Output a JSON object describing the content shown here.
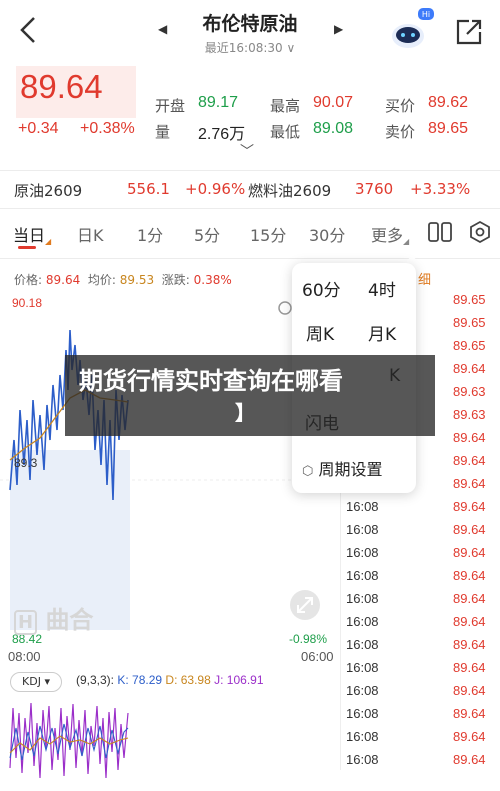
{
  "header": {
    "title": "布伦特原油",
    "subtitle": "最近16:08:30 ∨",
    "badge": "Hi"
  },
  "quote": {
    "price": "89.64",
    "change": "+0.34",
    "change_pct": "+0.38%",
    "open_label": "开盘",
    "open": "89.17",
    "high_label": "最高",
    "high": "90.07",
    "bid_label": "买价",
    "bid": "89.62",
    "vol_label": "量",
    "vol": "2.76万",
    "low_label": "最低",
    "low": "89.08",
    "ask_label": "卖价",
    "ask": "89.65"
  },
  "related": [
    {
      "name": "原油2609",
      "price": "556.1",
      "pct": "+0.96%"
    },
    {
      "name": "燃料油2609",
      "price": "3760",
      "pct": "+3.33%"
    }
  ],
  "tabs": [
    "当日",
    "日K",
    "1分",
    "5分",
    "15分",
    "30分",
    "更多"
  ],
  "info": {
    "price_label": "价格:",
    "price": "89.64",
    "avg_label": "均价:",
    "avg": "89.53",
    "chg_label": "涨跌:",
    "chg": "0.38%",
    "detail": "细"
  },
  "chart": {
    "top_label": "90.18",
    "mid_label": "89.3",
    "bottom_label": "88.42",
    "bottom_right_label": "-0.98%",
    "time_start": "08:00",
    "time_end": "06:00",
    "watermark": "曲合"
  },
  "ticks": [
    {
      "t": "",
      "p": "89.65"
    },
    {
      "t": "",
      "p": "89.65"
    },
    {
      "t": "",
      "p": "89.65"
    },
    {
      "t": "",
      "p": "89.64"
    },
    {
      "t": "",
      "p": "89.63"
    },
    {
      "t": "",
      "p": "89.63"
    },
    {
      "t": "",
      "p": "89.64"
    },
    {
      "t": "",
      "p": "89.64"
    },
    {
      "t": "",
      "p": "89.64"
    },
    {
      "t": "16:08",
      "p": "89.64"
    },
    {
      "t": "16:08",
      "p": "89.64"
    },
    {
      "t": "16:08",
      "p": "89.64"
    },
    {
      "t": "16:08",
      "p": "89.64"
    },
    {
      "t": "16:08",
      "p": "89.64"
    },
    {
      "t": "16:08",
      "p": "89.64"
    },
    {
      "t": "16:08",
      "p": "89.64"
    },
    {
      "t": "16:08",
      "p": "89.64"
    },
    {
      "t": "16:08",
      "p": "89.64"
    },
    {
      "t": "16:08",
      "p": "89.64"
    },
    {
      "t": "16:08",
      "p": "89.64"
    },
    {
      "t": "16:08",
      "p": "89.64"
    }
  ],
  "kdj": {
    "button": "KDJ ▾",
    "params": "(9,3,3):",
    "k": "K: 78.29",
    "d": "D: 63.98",
    "j": "J: 106.91"
  },
  "dropdown": {
    "items": [
      "60分",
      "4时",
      "周K",
      "月K",
      "K",
      "闪电",
      "周期设置"
    ]
  },
  "overlay": {
    "title": "期货行情实时查询在哪看",
    "bracket": "】"
  },
  "colors": {
    "up": "#e03a2e",
    "down": "#1e9e4a",
    "line": "#2d5ec9",
    "avg": "#c8861f"
  }
}
